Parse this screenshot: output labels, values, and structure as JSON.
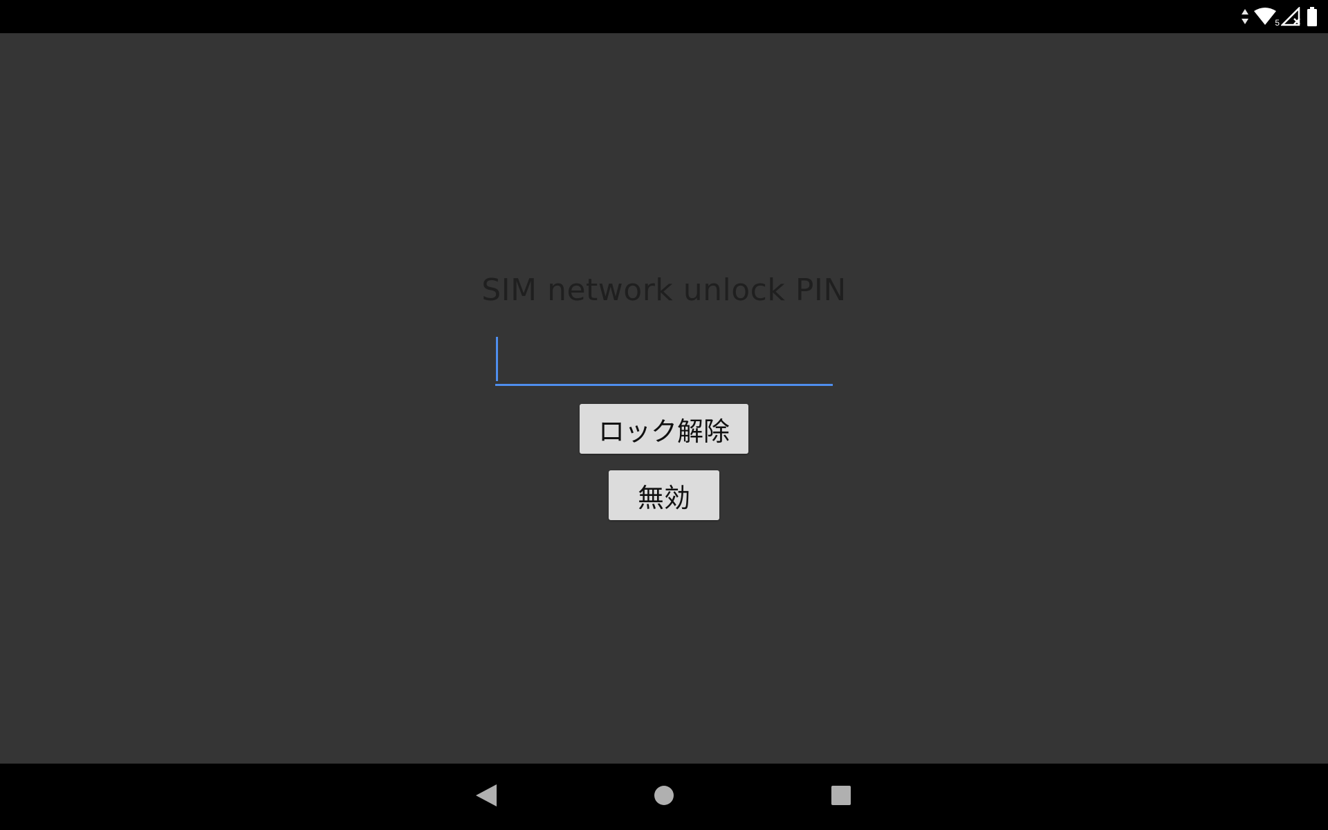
{
  "status_bar": {
    "icons": [
      "data-activity-icon",
      "wifi-icon",
      "no-signal-icon",
      "battery-icon"
    ],
    "wifi_badge": "5"
  },
  "screen": {
    "title": "SIM network unlock PIN",
    "pin_input": {
      "value": "",
      "placeholder": ""
    },
    "unlock_button_label": "ロック解除",
    "disable_button_label": "無効"
  },
  "nav_bar": {
    "icons": [
      "back-icon",
      "home-icon",
      "recents-icon"
    ]
  },
  "colors": {
    "background": "#353535",
    "bars": "#000000",
    "accent": "#4f8fef",
    "button": "#dcdcdc"
  }
}
